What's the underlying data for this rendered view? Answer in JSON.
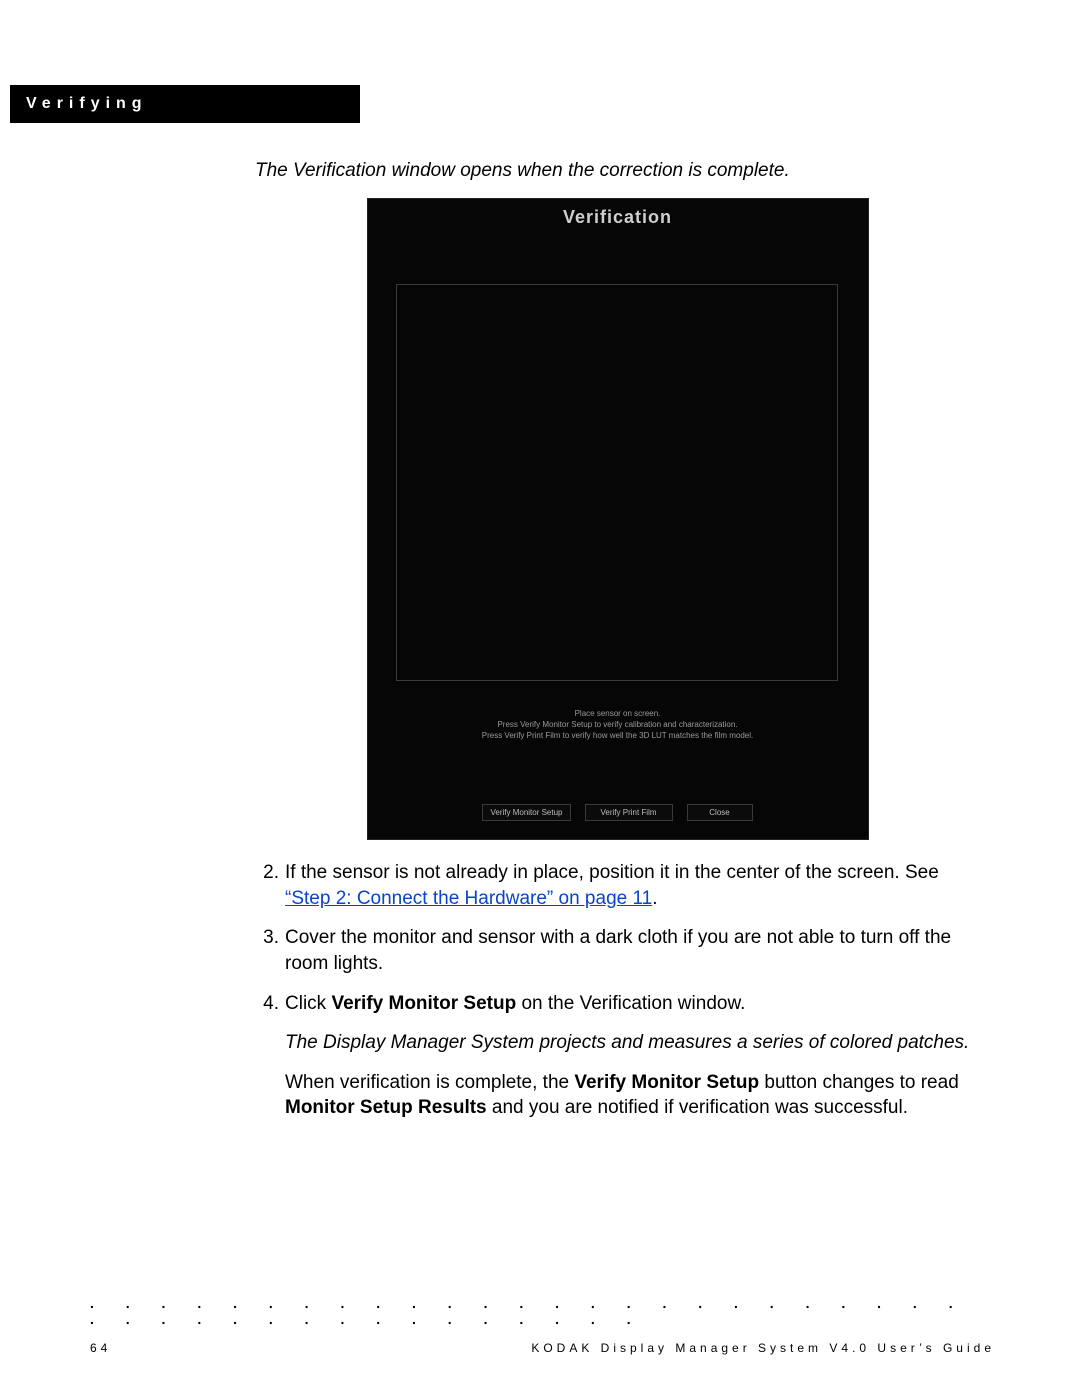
{
  "header": {
    "section": "Verifying"
  },
  "intro": "The Verification window opens when the correction is complete.",
  "verification": {
    "title": "Verification",
    "hint1": "Place sensor on screen.",
    "hint2": "Press Verify Monitor Setup to verify calibration and characterization.",
    "hint3": "Press Verify Print Film to verify how well the 3D LUT matches the film model.",
    "btn_monitor": "Verify Monitor Setup",
    "btn_print": "Verify Print Film",
    "btn_close": "Close"
  },
  "steps": {
    "s2_num": "2.",
    "s2_a": "If the sensor is not already in place, position it in the center of the screen. See ",
    "s2_link": "“Step 2: Connect the Hardware” on page 11",
    "s2_b": ".",
    "s3_num": "3.",
    "s3": "Cover the monitor and sensor with a dark cloth if you are not able to turn off the room lights.",
    "s4_num": "4.",
    "s4_a": "Click ",
    "s4_bold": "Verify Monitor Setup",
    "s4_b": " on the Verification window."
  },
  "result_note": "The Display Manager System projects and measures a series of colored patches.",
  "completion": {
    "a": "When verification is complete, the ",
    "b1": "Verify Monitor Setup",
    "c": " button changes to read ",
    "b2": "Monitor Setup Results",
    "d": " and you are notified if verification was successful."
  },
  "footer": {
    "page": "64",
    "title": "KODAK Display Manager System V4.0 User’s Guide"
  }
}
